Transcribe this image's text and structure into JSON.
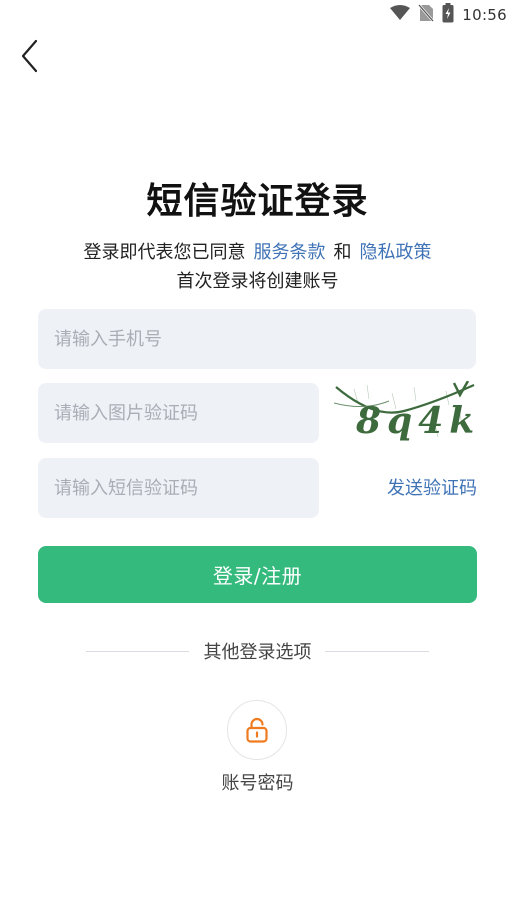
{
  "status_bar": {
    "time": "10:56",
    "icons": [
      "wifi-icon",
      "no-sim-icon",
      "battery-charging-icon"
    ]
  },
  "nav": {
    "back_icon": "chevron-left-icon"
  },
  "page": {
    "title": "短信验证登录",
    "agreement_prefix": "登录即代表您已同意",
    "terms_link": "服务条款",
    "agreement_and": "和",
    "privacy_link": "隐私政策",
    "subtitle": "首次登录将创建账号"
  },
  "form": {
    "phone_placeholder": "请输入手机号",
    "captcha_placeholder": "请输入图片验证码",
    "captcha_text": "8q4k",
    "sms_placeholder": "请输入短信验证码",
    "send_code_label": "发送验证码",
    "login_button": "登录/注册"
  },
  "other_login": {
    "label": "其他登录选项",
    "options": [
      {
        "label": "账号密码",
        "icon": "padlock-icon",
        "color": "#f07a1e"
      }
    ]
  },
  "colors": {
    "accent_green": "#35ba7e",
    "link_blue": "#3f73b6",
    "field_bg": "#eef1f6",
    "captcha_green": "#3d6b3d"
  }
}
